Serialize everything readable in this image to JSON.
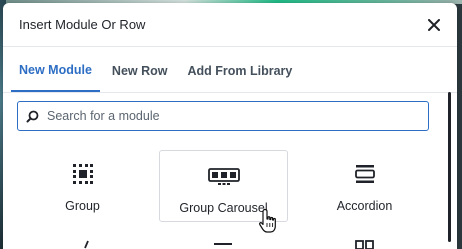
{
  "modal": {
    "title": "Insert Module Or Row",
    "close_label": "×"
  },
  "tabs": [
    {
      "label": "New Module",
      "active": true
    },
    {
      "label": "New Row",
      "active": false
    },
    {
      "label": "Add From Library",
      "active": false
    }
  ],
  "search": {
    "placeholder": "Search for a module",
    "value": ""
  },
  "modules": [
    {
      "label": "Group",
      "icon": "group-icon"
    },
    {
      "label": "Group Carousel",
      "icon": "group-carousel-icon"
    },
    {
      "label": "Accordion",
      "icon": "accordion-icon"
    }
  ],
  "colors": {
    "accent": "#2d6ec4",
    "text": "#1f2329",
    "border": "#e4e7eb"
  }
}
